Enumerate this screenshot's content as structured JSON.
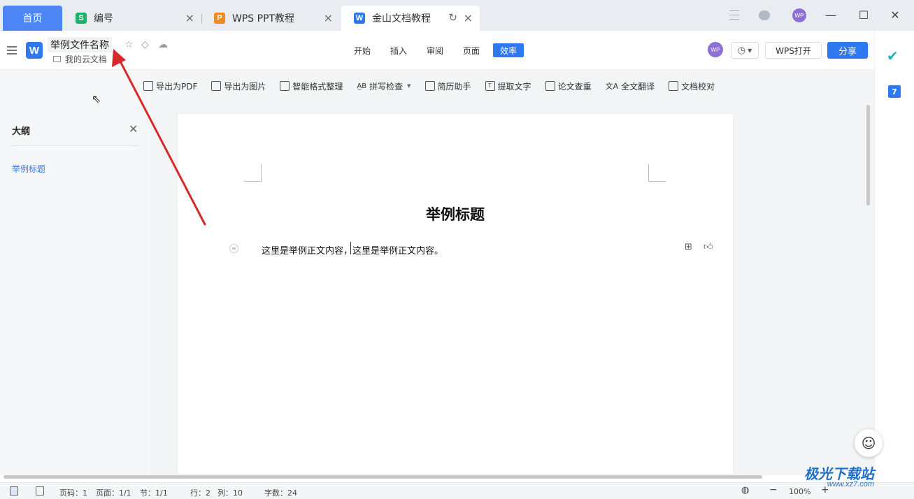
{
  "tabs": {
    "home": "首页",
    "items": [
      {
        "label": "编号",
        "logo": "S",
        "color": "#1fb16a"
      },
      {
        "label": "WPS PPT教程",
        "logo": "P",
        "color": "#f08a24"
      },
      {
        "label": "金山文档教程",
        "logo": "W",
        "color": "#2f79f0"
      }
    ]
  },
  "header": {
    "doc_title": "举例文件名称",
    "folder": "我的云文档",
    "logo": "W",
    "nav": [
      "开始",
      "插入",
      "审阅",
      "页面",
      "效率"
    ],
    "avatar": "WP",
    "wps_open": "WPS打开",
    "share": "分享"
  },
  "toolbar": {
    "items": [
      {
        "label": "导出为PDF",
        "icon": "export-pdf-icon"
      },
      {
        "label": "导出为图片",
        "icon": "export-image-icon"
      },
      {
        "label": "智能格式整理",
        "icon": "format-icon"
      },
      {
        "label": "拼写检查",
        "icon": "spellcheck-icon"
      },
      {
        "label": "简历助手",
        "icon": "resume-icon"
      },
      {
        "label": "提取文字",
        "icon": "extract-text-icon"
      },
      {
        "label": "论文查重",
        "icon": "plagiarism-icon"
      },
      {
        "label": "全文翻译",
        "icon": "translate-icon"
      },
      {
        "label": "文档校对",
        "icon": "proofread-icon"
      }
    ]
  },
  "outline": {
    "title": "大纲",
    "item": "举例标题"
  },
  "document": {
    "heading": "举例标题",
    "body": "这里是举例正文内容，这里是举例正文内容。"
  },
  "statusbar": {
    "page_num": "页码：1",
    "page": "页面：1/1",
    "section": "节：1/1",
    "row": "行：2",
    "col": "列：10",
    "words": "字数：24",
    "zoom": "100%"
  },
  "colors": {
    "accent": "#2f79f0",
    "home_tab": "#4e85f5",
    "annotation_arrow": "#d62a2a"
  }
}
